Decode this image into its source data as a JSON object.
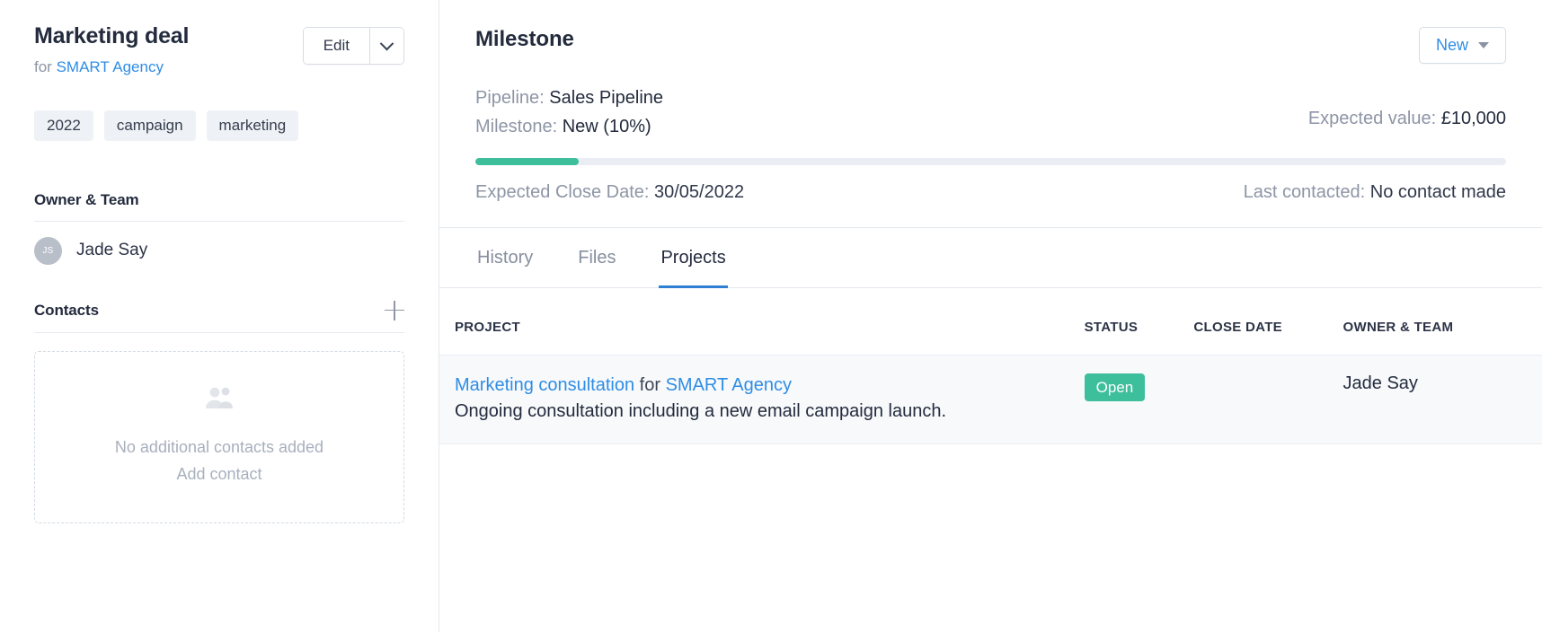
{
  "deal": {
    "title": "Marketing deal",
    "for_label": "for",
    "company": "SMART Agency",
    "edit_label": "Edit",
    "tags": [
      "2022",
      "campaign",
      "marketing"
    ]
  },
  "owner_section": {
    "title": "Owner & Team",
    "owner_initials": "JS",
    "owner_name": "Jade Say"
  },
  "contacts_section": {
    "title": "Contacts",
    "add_icon": "plus-icon",
    "empty_icon": "people-icon",
    "empty_text": "No additional contacts added",
    "add_contact_label": "Add contact"
  },
  "milestone_panel": {
    "title": "Milestone",
    "new_button": "New",
    "pipeline_label": "Pipeline:",
    "pipeline_value": "Sales Pipeline",
    "milestone_label": "Milestone:",
    "milestone_value": "New (10%)",
    "expected_value_label": "Expected value:",
    "expected_value": "£10,000",
    "close_date_label": "Expected Close Date:",
    "close_date_value": "30/05/2022",
    "last_contacted_label": "Last contacted:",
    "last_contacted_value": "No contact made",
    "progress_percent": 10,
    "progress_color": "#3ebf9b",
    "track_color": "#eaedf3"
  },
  "tabs": [
    {
      "label": "History",
      "active": false
    },
    {
      "label": "Files",
      "active": false
    },
    {
      "label": "Projects",
      "active": true
    }
  ],
  "projects_table": {
    "columns": {
      "project": "PROJECT",
      "status": "STATUS",
      "close_date": "CLOSE DATE",
      "owner": "OWNER & TEAM"
    },
    "rows": [
      {
        "name": "Marketing consultation",
        "for_word": "for",
        "company": "SMART Agency",
        "description": "Ongoing consultation including a new email campaign launch.",
        "status": "Open",
        "status_color": "#3ebf9b",
        "close_date": "",
        "owner": "Jade Say"
      }
    ]
  },
  "accent": {
    "link": "#2f8de4",
    "tab_underline": "#2f7fd4",
    "text": "#232b3d",
    "muted": "#8d95a5"
  }
}
